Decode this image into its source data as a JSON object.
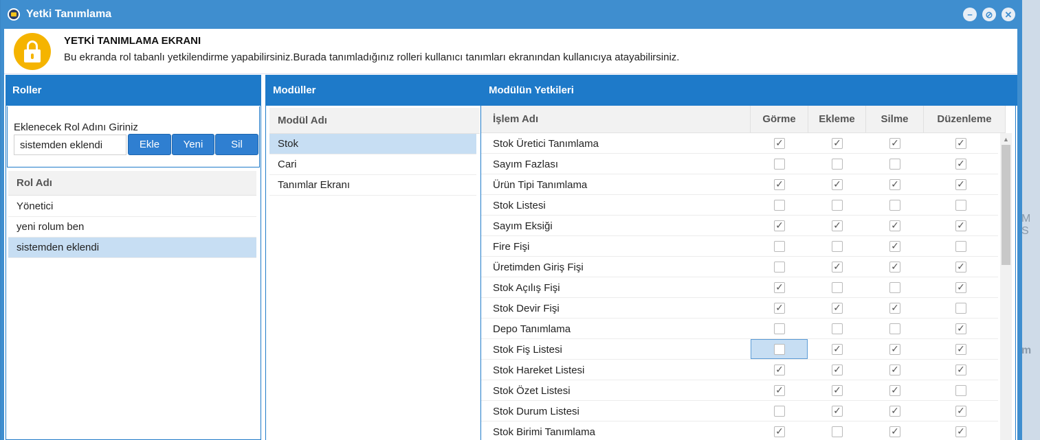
{
  "window": {
    "title": "Yetki Tanımlama"
  },
  "header": {
    "title": "YETKİ TANIMLAMA EKRANI",
    "description": "Bu ekranda rol tabanlı yetkilendirme yapabilirsiniz.Burada tanımladığınız rolleri kullanıcı tanımları ekranından kullanıcıya atayabilirsiniz."
  },
  "roller": {
    "title": "Roller",
    "add_label": "Eklenecek Rol Adını Giriniz",
    "input_value": "sistemden eklendi",
    "btn_ekle": "Ekle",
    "btn_yeni": "Yeni",
    "btn_sil": "Sil",
    "col_header": "Rol Adı",
    "items": [
      {
        "label": "Yönetici",
        "selected": false
      },
      {
        "label": "yeni rolum ben",
        "selected": false
      },
      {
        "label": "sistemden eklendi",
        "selected": true
      }
    ]
  },
  "moduller": {
    "title": "Modüller",
    "col_header": "Modül Adı",
    "items": [
      {
        "label": "Stok",
        "selected": true
      },
      {
        "label": "Cari",
        "selected": false
      },
      {
        "label": "Tanımlar Ekranı",
        "selected": false
      }
    ]
  },
  "yetkiler": {
    "title": "Modülün Yetkileri",
    "col_headers": [
      "İşlem Adı",
      "Görme",
      "Ekleme",
      "Silme",
      "Düzenleme"
    ],
    "rows": [
      {
        "name": "Stok Üretici Tanımlama",
        "gorme": true,
        "ekleme": true,
        "silme": true,
        "duzenleme": true
      },
      {
        "name": "Sayım Fazlası",
        "gorme": false,
        "ekleme": false,
        "silme": false,
        "duzenleme": true
      },
      {
        "name": "Ürün Tipi Tanımlama",
        "gorme": true,
        "ekleme": true,
        "silme": true,
        "duzenleme": true
      },
      {
        "name": "Stok Listesi",
        "gorme": false,
        "ekleme": false,
        "silme": false,
        "duzenleme": false
      },
      {
        "name": "Sayım Eksiği",
        "gorme": true,
        "ekleme": true,
        "silme": true,
        "duzenleme": true
      },
      {
        "name": "Fire Fişi",
        "gorme": false,
        "ekleme": false,
        "silme": true,
        "duzenleme": false
      },
      {
        "name": "Üretimden Giriş Fişi",
        "gorme": false,
        "ekleme": true,
        "silme": true,
        "duzenleme": true
      },
      {
        "name": "Stok Açılış Fişi",
        "gorme": true,
        "ekleme": false,
        "silme": false,
        "duzenleme": true
      },
      {
        "name": "Stok Devir Fişi",
        "gorme": true,
        "ekleme": true,
        "silme": true,
        "duzenleme": false
      },
      {
        "name": "Depo Tanımlama",
        "gorme": false,
        "ekleme": false,
        "silme": false,
        "duzenleme": true
      },
      {
        "name": "Stok Fiş Listesi",
        "gorme": false,
        "ekleme": true,
        "silme": true,
        "duzenleme": true,
        "focused": "gorme"
      },
      {
        "name": "Stok Hareket Listesi",
        "gorme": true,
        "ekleme": true,
        "silme": true,
        "duzenleme": true
      },
      {
        "name": "Stok Özet Listesi",
        "gorme": true,
        "ekleme": true,
        "silme": true,
        "duzenleme": false
      },
      {
        "name": "Stok Durum Listesi",
        "gorme": false,
        "ekleme": true,
        "silme": true,
        "duzenleme": true
      },
      {
        "name": "Stok Birimi Tanımlama",
        "gorme": true,
        "ekleme": false,
        "silme": true,
        "duzenleme": true
      }
    ]
  },
  "background": {
    "fragment_1": "M S",
    "fragment_2": "m"
  },
  "colors": {
    "titlebar": "#3f8ecf",
    "panel_header": "#1e7ac9",
    "selection": "#c7def3",
    "lock_icon": "#f5b400"
  }
}
